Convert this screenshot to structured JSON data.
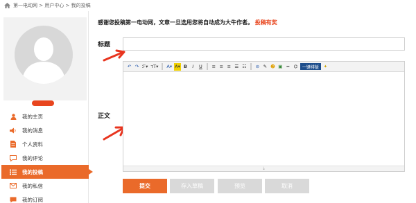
{
  "breadcrumb": {
    "text": "第一电动网 > 用户中心 > 我的投稿"
  },
  "sidebar": {
    "menu": [
      {
        "label": "我的主页",
        "icon": "user-icon",
        "active": false
      },
      {
        "label": "我的消息",
        "icon": "speaker-icon",
        "active": false
      },
      {
        "label": "个人资料",
        "icon": "document-icon",
        "active": false
      },
      {
        "label": "我的评论",
        "icon": "comment-icon",
        "active": false
      },
      {
        "label": "我的投稿",
        "icon": "list-icon",
        "active": true
      },
      {
        "label": "我的私信",
        "icon": "mail-icon",
        "active": false
      },
      {
        "label": "我的订阅",
        "icon": "subscribe-icon",
        "active": false
      }
    ]
  },
  "notice": {
    "text": "感谢您投稿第一电动网，文章一旦选用您将自动成为大牛作者。",
    "link": "投稿有奖"
  },
  "form": {
    "title_label": "标题",
    "title_value": "",
    "body_label": "正文",
    "toolbar_one_key": "一键排版"
  },
  "buttons": {
    "submit": "提交",
    "save_draft": "存入草稿",
    "preview": "预览",
    "cancel": "取消"
  },
  "colors": {
    "accent": "#ea6a2a",
    "link": "#e8451e",
    "disabled": "#d9d9d9"
  }
}
